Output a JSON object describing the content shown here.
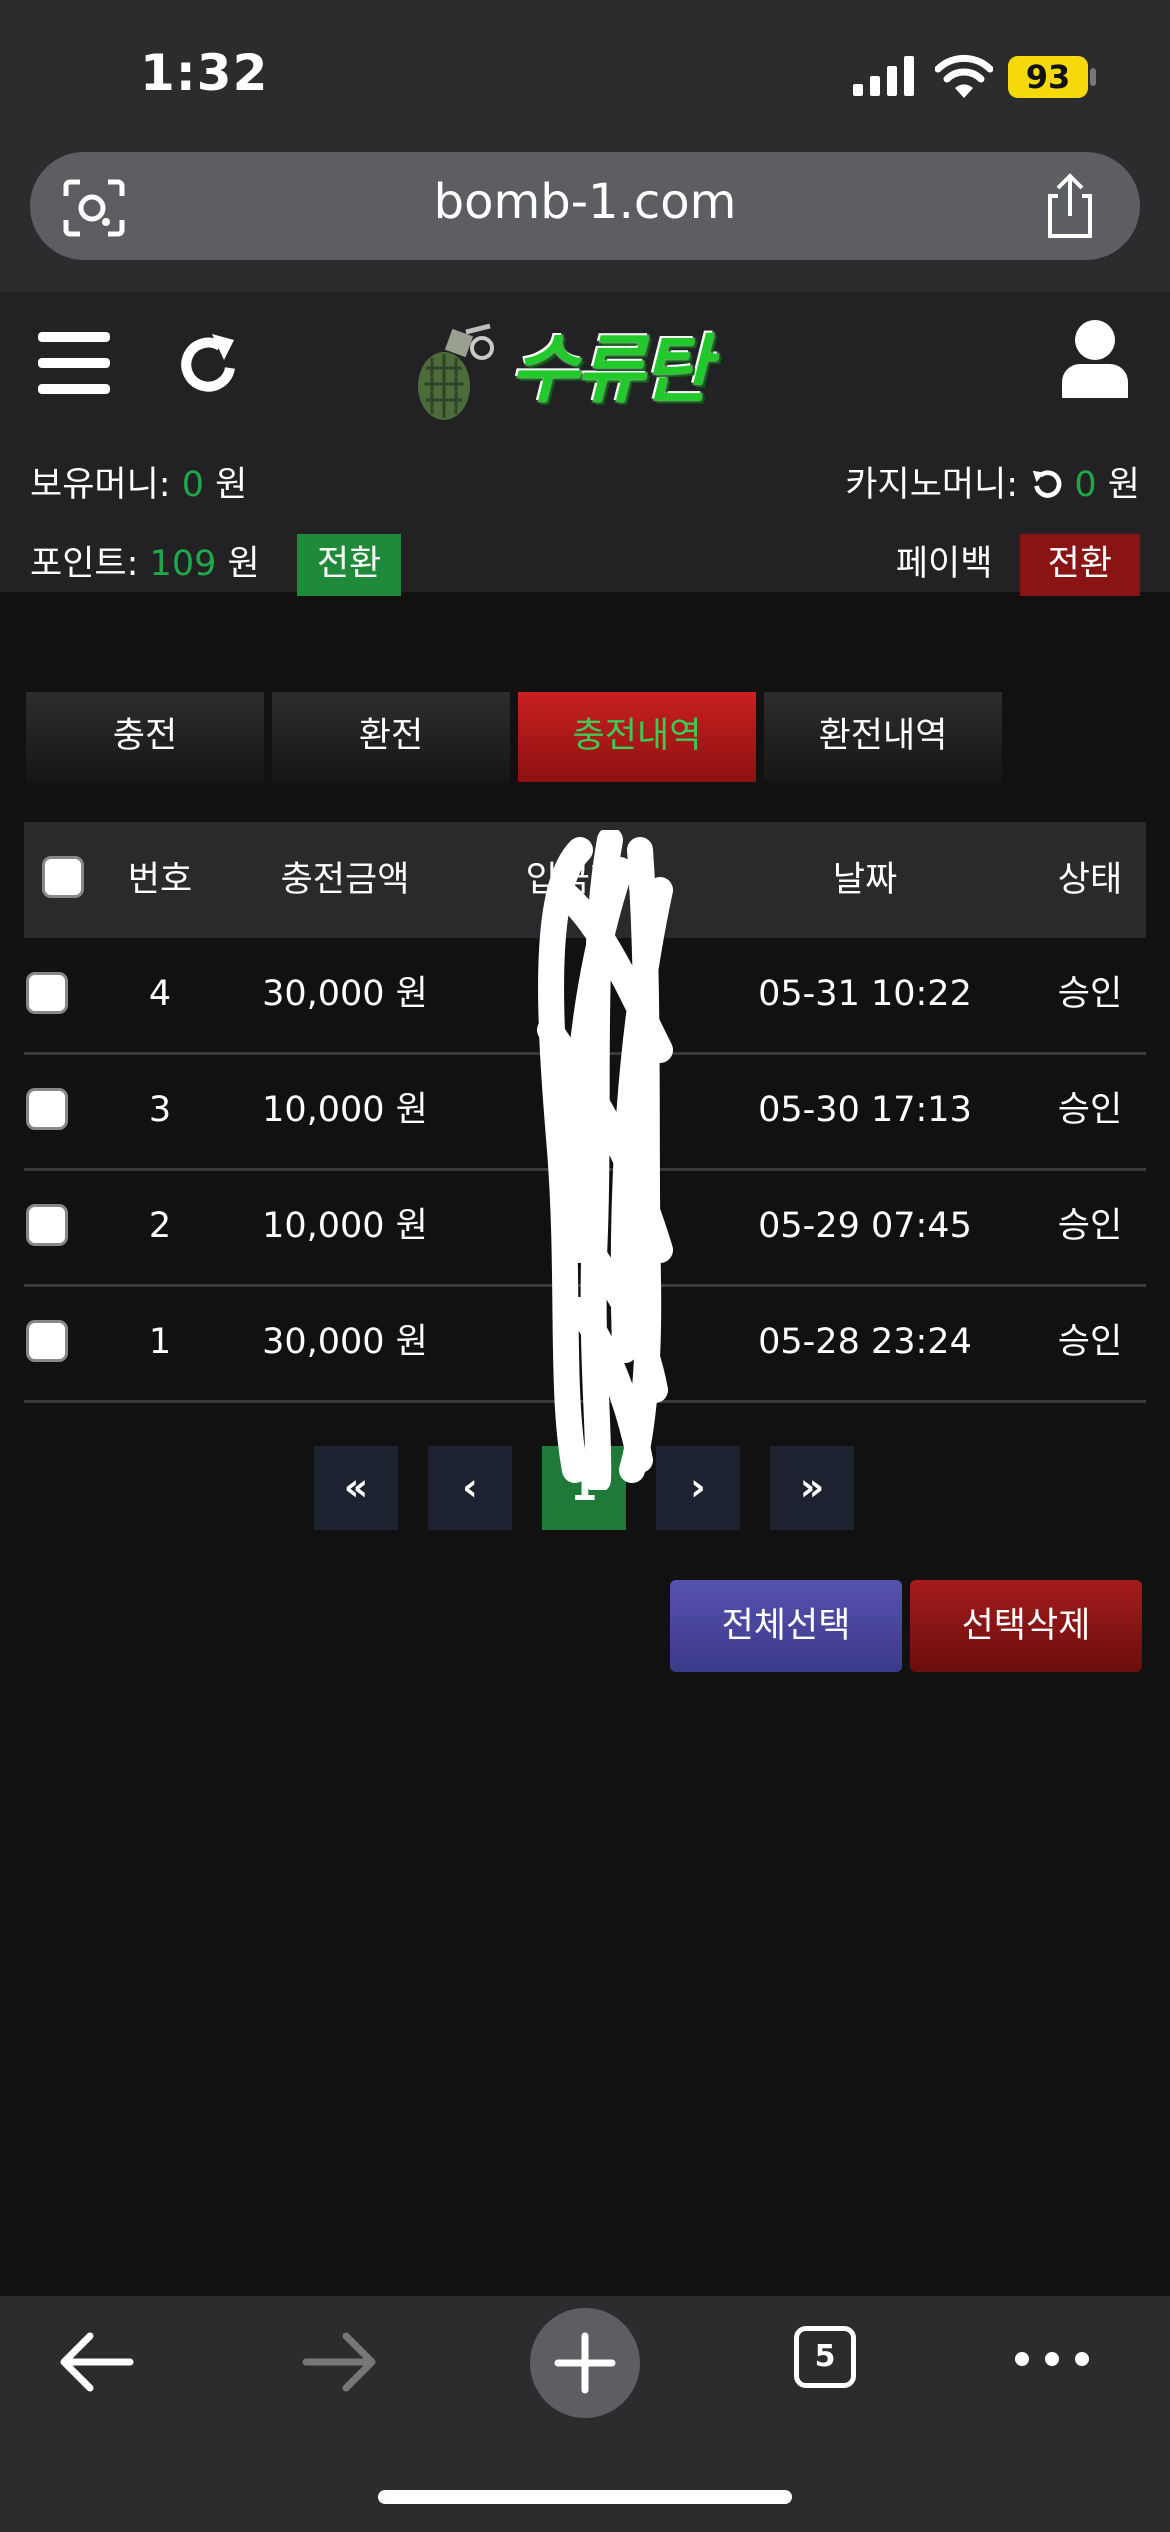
{
  "status_bar": {
    "time": "1:32",
    "battery": "93"
  },
  "browser": {
    "url": "bomb-1.com",
    "tabs_count": "5"
  },
  "site": {
    "logo_text": "수류탄",
    "money_label": "보유머니:",
    "money_value": "0",
    "won": "원",
    "casino_label": "카지노머니:",
    "casino_value": "0",
    "point_label": "포인트:",
    "point_value": "109",
    "point_convert": "전환",
    "payback_label": "페이백",
    "payback_convert": "전환"
  },
  "tabs": [
    {
      "label": "충전",
      "active": false
    },
    {
      "label": "환전",
      "active": false
    },
    {
      "label": "충전내역",
      "active": true
    },
    {
      "label": "환전내역",
      "active": false
    }
  ],
  "table": {
    "headers": {
      "no": "번호",
      "amount": "충전금액",
      "depositor": "입금자명",
      "date": "날짜",
      "status": "상태"
    },
    "rows": [
      {
        "no": "4",
        "amount": "30,000 원",
        "date": "05-31 10:22",
        "status": "승인"
      },
      {
        "no": "3",
        "amount": "10,000 원",
        "date": "05-30 17:13",
        "status": "승인"
      },
      {
        "no": "2",
        "amount": "10,000 원",
        "date": "05-29 07:45",
        "status": "승인"
      },
      {
        "no": "1",
        "amount": "30,000 원",
        "date": "05-28 23:24",
        "status": "승인"
      }
    ]
  },
  "pagination": {
    "first": "«",
    "prev": "‹",
    "current": "1",
    "next": "›",
    "last": "»"
  },
  "actions": {
    "select_all": "전체선택",
    "delete_selected": "선택삭제"
  },
  "colors": {
    "accent_green": "#1fa84a",
    "accent_red": "#8e1111",
    "button_purple": "#4a47a0"
  }
}
